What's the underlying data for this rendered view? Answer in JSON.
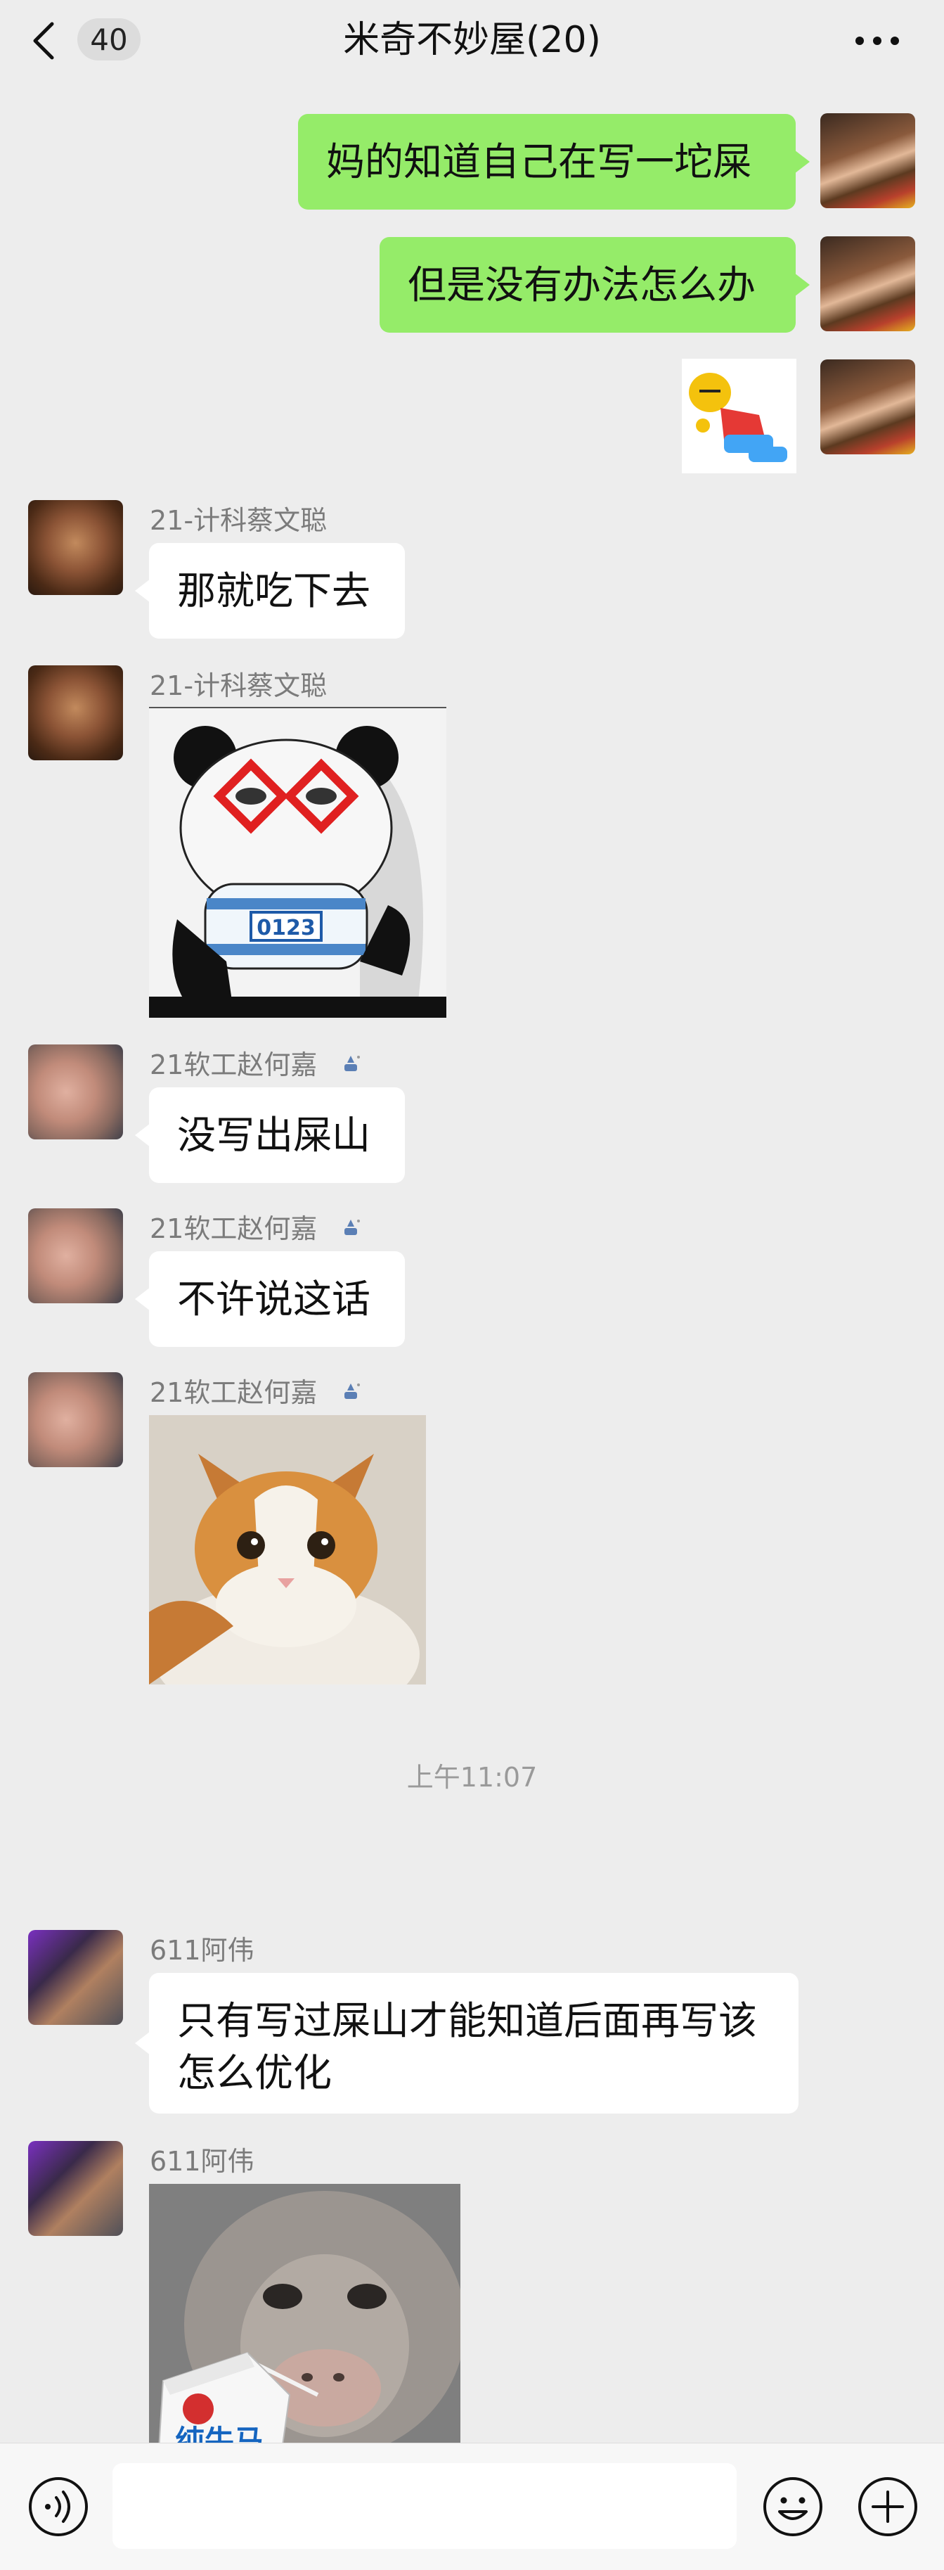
{
  "header": {
    "unread_count": "40",
    "title": "米奇不妙屋(20)",
    "back_icon": "chevron-left-icon",
    "more_icon": "ellipsis-icon"
  },
  "messages": [
    {
      "type": "text",
      "side": "right",
      "text": "妈的知道自己在写一坨屎"
    },
    {
      "type": "text",
      "side": "right",
      "text": "但是没有办法怎么办"
    },
    {
      "type": "sticker",
      "side": "right",
      "sticker": "lying-cartoon-figure-sticker"
    },
    {
      "type": "text",
      "side": "left",
      "sender": "21-计科蔡文聪",
      "text": "那就吃下去"
    },
    {
      "type": "sticker",
      "side": "left",
      "sender": "21-计科蔡文聪",
      "sticker": "panda-glasses-sticker",
      "sticker_text": "0123"
    },
    {
      "type": "text",
      "side": "left",
      "sender": "21软工赵何嘉",
      "text": "没写出屎山"
    },
    {
      "type": "text",
      "side": "left",
      "sender": "21软工赵何嘉",
      "text": "不许说这话"
    },
    {
      "type": "sticker",
      "side": "left",
      "sender": "21软工赵何嘉",
      "sticker": "orange-white-cat-sticker"
    },
    {
      "type": "time",
      "text": "上午11:07"
    },
    {
      "type": "text",
      "side": "left",
      "sender": "611阿伟",
      "text": "只有写过屎山才能知道后面再写该\n怎么优化"
    },
    {
      "type": "sticker",
      "side": "left",
      "sender": "611阿伟",
      "sticker": "monkey-milk-carton-sticker",
      "sticker_text": "纯牛马"
    }
  ],
  "input_bar": {
    "voice_icon": "voice-icon",
    "emoji_icon": "emoji-icon",
    "plus_icon": "plus-icon",
    "placeholder": ""
  },
  "colors": {
    "background": "#ededed",
    "self_bubble": "#95ec69",
    "other_bubble": "#ffffff"
  }
}
